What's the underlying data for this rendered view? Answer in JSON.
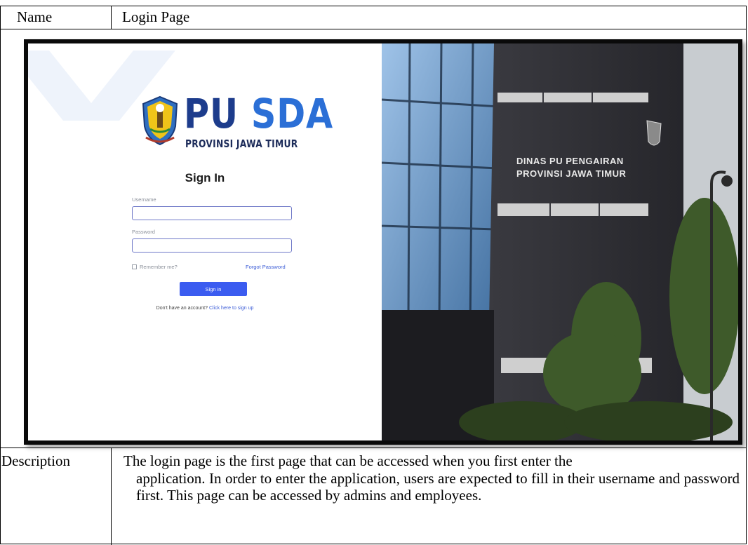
{
  "table": {
    "name_label": "Name",
    "name_value": "Login Page",
    "description_label": "Description",
    "description_first": "The login page is the first page that can be accessed when you first enter the",
    "description_rest": "application. In order to enter the application, users are expected to fill in their username and password first. This page can be accessed by admins and employees."
  },
  "login": {
    "logo_pu": "PU",
    "logo_sda": "SDA",
    "logo_subtitle": "PROVINSI JAWA TIMUR",
    "title": "Sign In",
    "username_label": "Username",
    "password_label": "Password",
    "remember_label": "Remember me?",
    "forgot_label": "Forgot Password",
    "signin_button": "Sign in",
    "signup_prompt": "Don't have an account?",
    "signup_link": "Click here to sign up"
  },
  "building": {
    "line1": "DINAS PU PENGAIRAN",
    "line2": "PROVINSI JAWA TIMUR"
  },
  "colors": {
    "primary": "#3b5cf0",
    "logo_dark": "#1d3c8c",
    "logo_light": "#2b6fd6"
  }
}
